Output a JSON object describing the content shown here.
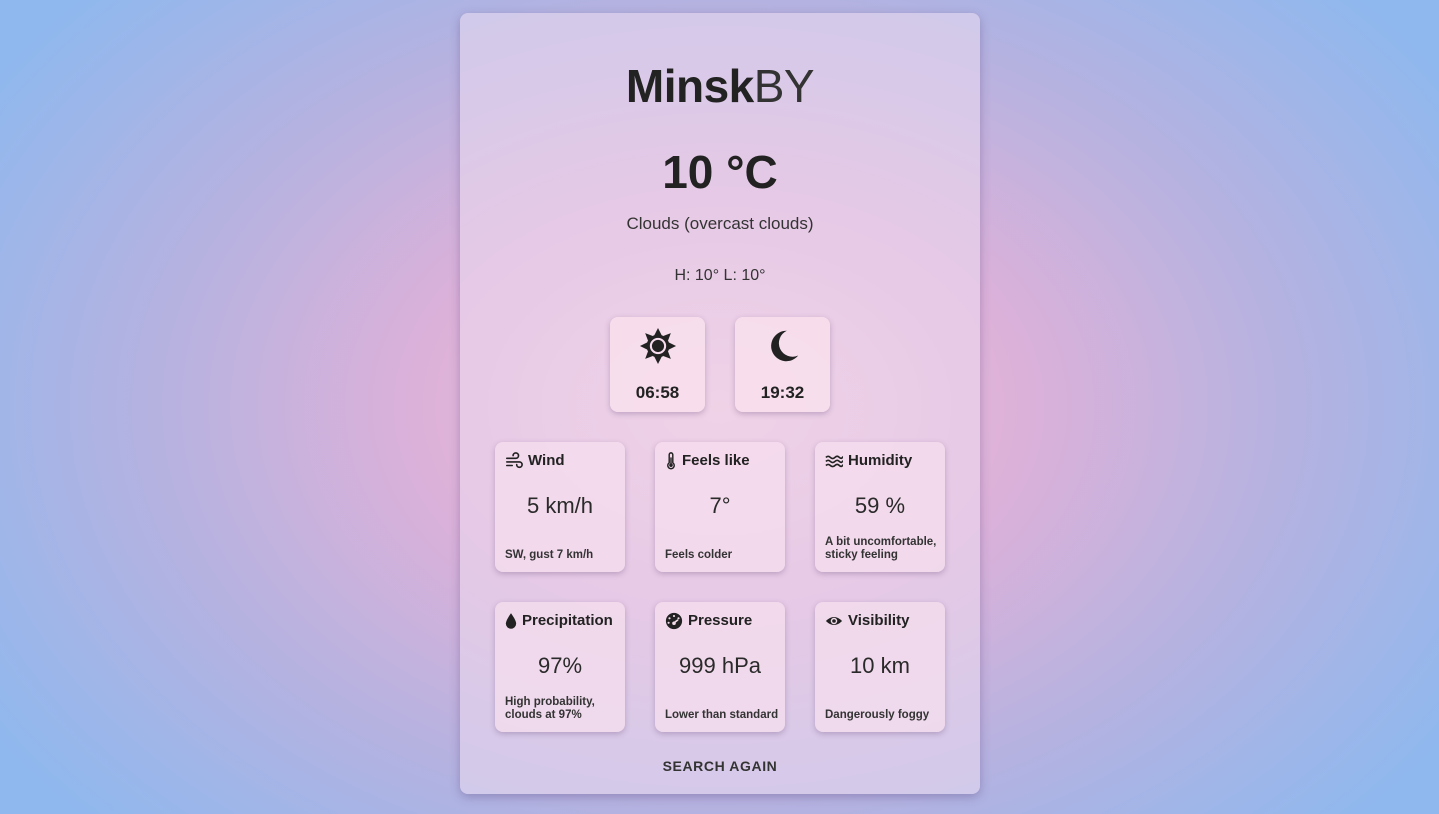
{
  "location": {
    "city": "Minsk",
    "country": "BY"
  },
  "current": {
    "temperature": "10 °C",
    "description": "Clouds (overcast clouds)",
    "hi_lo": "H: 10° L: 10°"
  },
  "sun": {
    "sunrise": {
      "icon": "sun-icon",
      "time": "06:58"
    },
    "sunset": {
      "icon": "moon-icon",
      "time": "19:32"
    }
  },
  "details": {
    "wind": {
      "icon": "wind-icon",
      "label": "Wind",
      "value": "5 km/h",
      "note": "SW, gust 7 km/h"
    },
    "feels_like": {
      "icon": "thermometer-icon",
      "label": "Feels like",
      "value": "7°",
      "note": "Feels colder"
    },
    "humidity": {
      "icon": "waves-icon",
      "label": "Humidity",
      "value": "59 %",
      "note": "A bit uncomfortable, sticky feeling"
    },
    "precipitation": {
      "icon": "droplet-icon",
      "label": "Precipitation",
      "value": "97%",
      "note": "High probability, clouds at 97%"
    },
    "pressure": {
      "icon": "gauge-icon",
      "label": "Pressure",
      "value": "999 hPa",
      "note": "Lower than standard"
    },
    "visibility": {
      "icon": "eye-icon",
      "label": "Visibility",
      "value": "10 km",
      "note": "Dangerously foggy"
    }
  },
  "actions": {
    "search_again": "SEARCH AGAIN"
  },
  "colors": {
    "text": "#222222",
    "background_center": "#f3c6dc",
    "background_edge": "#8fb8ee"
  }
}
